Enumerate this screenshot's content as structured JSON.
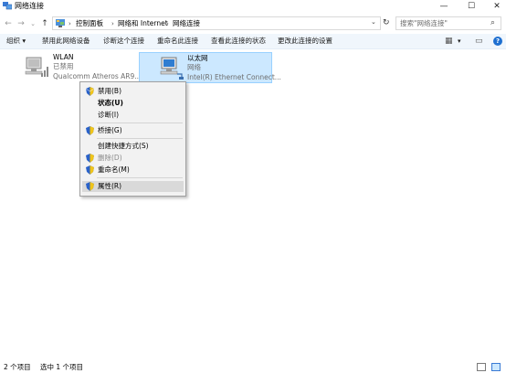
{
  "window": {
    "title": "网络连接",
    "minimize_glyph": "—",
    "maximize_glyph": "☐",
    "close_glyph": "✕"
  },
  "nav": {
    "back_glyph": "←",
    "forward_glyph": "→",
    "dropdown_glyph": "⌄",
    "up_glyph": "↑",
    "refresh_glyph": "↻",
    "breadcrumb": [
      "控制面板",
      "网络和 Internet",
      "网络连接"
    ],
    "crumb_separator": "›",
    "search_placeholder": "搜索\"网络连接\"",
    "search_glyph": "⌕"
  },
  "toolbar": {
    "organize": "组织 ▾",
    "disable": "禁用此网络设备",
    "diagnose": "诊断这个连接",
    "rename": "重命名此连接",
    "view_status": "查看此连接的状态",
    "change_settings": "更改此连接的设置",
    "view_glyph": "▦",
    "view_dropdown": "▾",
    "pane_glyph": "▭",
    "help_glyph": "?"
  },
  "connections": [
    {
      "name": "WLAN",
      "status": "已禁用",
      "adapter": "Qualcomm Atheros AR9...",
      "icon": "wifi-adapter-icon"
    },
    {
      "name": "以太网",
      "status": "网络",
      "adapter": "Intel(R) Ethernet Connect...",
      "icon": "ethernet-adapter-icon"
    }
  ],
  "context_menu": {
    "items": [
      {
        "label": "禁用(B)",
        "shield": true,
        "bold": false,
        "disabled": false
      },
      {
        "label": "状态(U)",
        "shield": false,
        "bold": true,
        "disabled": false
      },
      {
        "label": "诊断(I)",
        "shield": false,
        "bold": false,
        "disabled": false
      },
      {
        "label": "桥接(G)",
        "shield": true,
        "bold": false,
        "disabled": false
      },
      {
        "label": "创建快捷方式(S)",
        "shield": false,
        "bold": false,
        "disabled": false
      },
      {
        "label": "删除(D)",
        "shield": true,
        "bold": false,
        "disabled": true
      },
      {
        "label": "重命名(M)",
        "shield": true,
        "bold": false,
        "disabled": false
      },
      {
        "label": "属性(R)",
        "shield": true,
        "bold": false,
        "disabled": false,
        "hovered": true
      }
    ]
  },
  "status": {
    "item_count": "2 个项目",
    "selected": "选中 1 个项目"
  },
  "colors": {
    "selection_bg": "#cce8ff",
    "toolbar_bg": "#f0f6fc",
    "menu_bg": "#f2f2f2"
  }
}
